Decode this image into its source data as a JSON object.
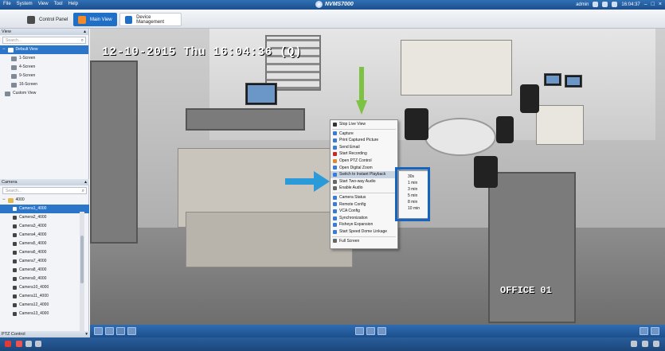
{
  "titlebar": {
    "menu": [
      "File",
      "System",
      "View",
      "Tool",
      "Help"
    ],
    "app_title": "NVMS7000",
    "user": "admin",
    "time": "16:04:37"
  },
  "tabs": [
    {
      "label": "Control Panel",
      "icon": "control-panel-icon"
    },
    {
      "label": "Main View",
      "icon": "main-view-icon"
    },
    {
      "label": "Device Management",
      "icon": "device-management-icon"
    }
  ],
  "view_panel": {
    "title": "View",
    "search_placeholder": "Search...",
    "items": [
      {
        "label": "Default View",
        "selected": true
      },
      {
        "label": "1-Screen"
      },
      {
        "label": "4-Screen"
      },
      {
        "label": "9-Screen"
      },
      {
        "label": "16-Screen"
      },
      {
        "label": "Custom View"
      }
    ]
  },
  "camera_panel": {
    "title": "Camera",
    "search_placeholder": "Search...",
    "group": "4000",
    "cameras": [
      "Camera1_4000",
      "Camera2_4000",
      "Camera3_4000",
      "Camera4_4000",
      "Camera5_4000",
      "Camera6_4000",
      "Camera7_4000",
      "Camera8_4000",
      "Camera9_4000",
      "Camera10_4000",
      "Camera11_4000",
      "Camera12_4000",
      "Camera13_4000"
    ],
    "selected_index": 0
  },
  "ptz_panel": {
    "title": "PTZ Control"
  },
  "video": {
    "osd_time": "12-10-2015 Thu 16:04:36 (Q)",
    "osd_label": "OFFICE 01"
  },
  "context_menu": {
    "items": [
      {
        "label": "Stop Live View",
        "icon": "stop-icon",
        "color": "#333333"
      },
      {
        "sep": true
      },
      {
        "label": "Capture",
        "icon": "camera-icon",
        "color": "#3a7bd5"
      },
      {
        "label": "Print Captured Picture",
        "icon": "print-icon",
        "color": "#3a7bd5"
      },
      {
        "label": "Send Email",
        "icon": "email-icon",
        "color": "#3a7bd5"
      },
      {
        "label": "Start Recording",
        "icon": "record-icon",
        "color": "#c62828"
      },
      {
        "label": "Open PTZ Control",
        "icon": "ptz-icon",
        "color": "#e08a2e"
      },
      {
        "label": "Open Digital Zoom",
        "icon": "zoom-icon",
        "color": "#3a7bd5"
      },
      {
        "label": "Switch to Instant Playback",
        "icon": "playback-icon",
        "color": "#3a7bd5",
        "highlighted": true
      },
      {
        "label": "Start Two-way Audio",
        "icon": "microphone-icon",
        "color": "#666666"
      },
      {
        "label": "Enable Audio",
        "icon": "speaker-icon",
        "color": "#666666"
      },
      {
        "sep": true
      },
      {
        "label": "Camera Status",
        "icon": "status-icon",
        "color": "#3a7bd5"
      },
      {
        "label": "Remote Config",
        "icon": "config-icon",
        "color": "#3a7bd5"
      },
      {
        "label": "VCA Config",
        "icon": "vca-icon",
        "color": "#3a7bd5"
      },
      {
        "label": "Synchronization",
        "icon": "sync-icon",
        "color": "#3a7bd5"
      },
      {
        "label": "Fisheye Expansion",
        "icon": "fisheye-icon",
        "color": "#3a7bd5"
      },
      {
        "label": "Start Speed Dome Linkage",
        "icon": "linkage-icon",
        "color": "#3a7bd5"
      },
      {
        "sep": true
      },
      {
        "label": "Full Screen",
        "icon": "fullscreen-icon",
        "color": "#666666"
      }
    ]
  },
  "submenu": {
    "items": [
      "30s",
      "1 min",
      "3 min",
      "5 min",
      "8 min",
      "10 min"
    ]
  },
  "colors": {
    "accent": "#1f6fc6",
    "highlight_box": "#1565c0",
    "arrow_green": "#7dc242",
    "arrow_blue": "#2a9bd8"
  }
}
